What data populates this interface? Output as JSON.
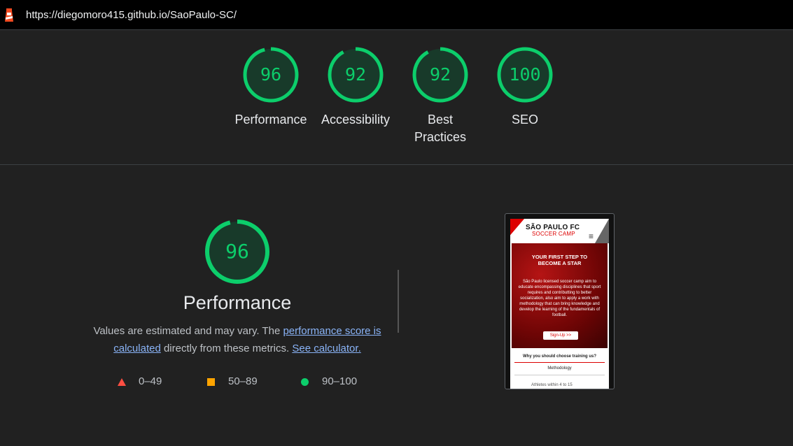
{
  "browser": {
    "url": "https://diegomoro415.github.io/SaoPaulo-SC/"
  },
  "gauges": [
    {
      "score": "96",
      "label": "Performance"
    },
    {
      "score": "92",
      "label": "Accessibility"
    },
    {
      "score": "92",
      "label": "Best Practices"
    },
    {
      "score": "100",
      "label": "SEO"
    }
  ],
  "performance": {
    "score": "96",
    "title": "Performance",
    "desc_pre": "Values are estimated and may vary. The ",
    "desc_link1": "performance score is calculated",
    "desc_mid": " directly from these metrics. ",
    "desc_link2": "See calculator."
  },
  "legend": {
    "fail": "0–49",
    "average": "50–89",
    "pass": "90–100"
  },
  "colors": {
    "pass": "#0cce6b",
    "average": "#ffa400",
    "fail": "#ff4e42"
  },
  "screenshot": {
    "logo_top": "SÃO PAULO FC",
    "logo_bottom": "SOCCER CAMP",
    "hero_title_1": "YOUR FIRST STEP TO",
    "hero_title_2": "BECOME A STAR",
    "hero_text": "São Paulo licensed soccer camp aim to educate encompassing disciplines that sport requires and contributting to better socialization, also aim to apply a work with methodology that can bring knowledge and develop the learning of the fundamentals of football.",
    "cta": "Sign-Up >>",
    "question": "Why you should choose training us?",
    "methodology": "Methodology",
    "athletes": "Athletes within 4 to 15"
  }
}
